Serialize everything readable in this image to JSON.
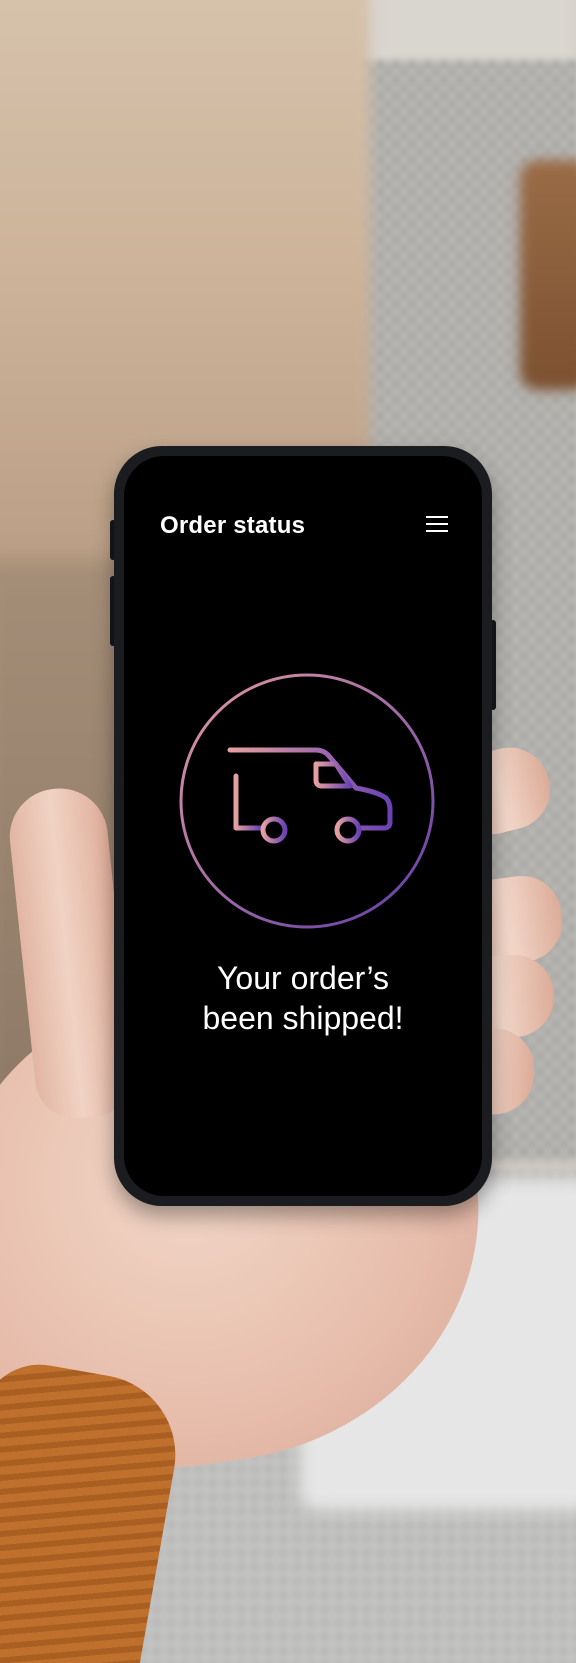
{
  "screen": {
    "title": "Order status",
    "menu_icon": "hamburger-menu-icon",
    "status_icon": "delivery-van-icon",
    "message_line1": "Your order’s",
    "message_line2": "been shipped!"
  },
  "colors": {
    "screen_background": "#000000",
    "text": "#ffffff",
    "gradient_start": "#d98ea0",
    "gradient_end": "#6a3fb0"
  }
}
